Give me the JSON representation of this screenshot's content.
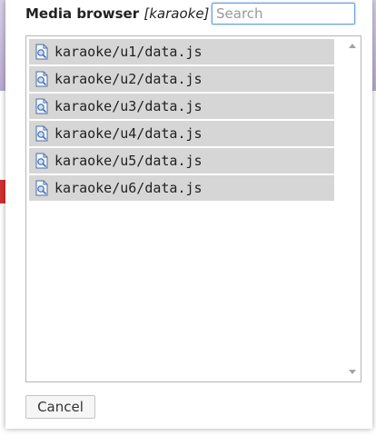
{
  "dialog": {
    "title": "Media browser",
    "context": "[karaoke]",
    "search": {
      "placeholder": "Search",
      "value": ""
    },
    "items": [
      {
        "label": "karaoke/u1/data.js",
        "icon": "script-file-icon"
      },
      {
        "label": "karaoke/u2/data.js",
        "icon": "script-file-icon"
      },
      {
        "label": "karaoke/u3/data.js",
        "icon": "script-file-icon"
      },
      {
        "label": "karaoke/u4/data.js",
        "icon": "script-file-icon"
      },
      {
        "label": "karaoke/u5/data.js",
        "icon": "script-file-icon"
      },
      {
        "label": "karaoke/u6/data.js",
        "icon": "script-file-icon"
      }
    ],
    "cancel_label": "Cancel"
  },
  "colors": {
    "item_background": "#d6d6d6",
    "search_focus_border": "#6b9fd6"
  }
}
